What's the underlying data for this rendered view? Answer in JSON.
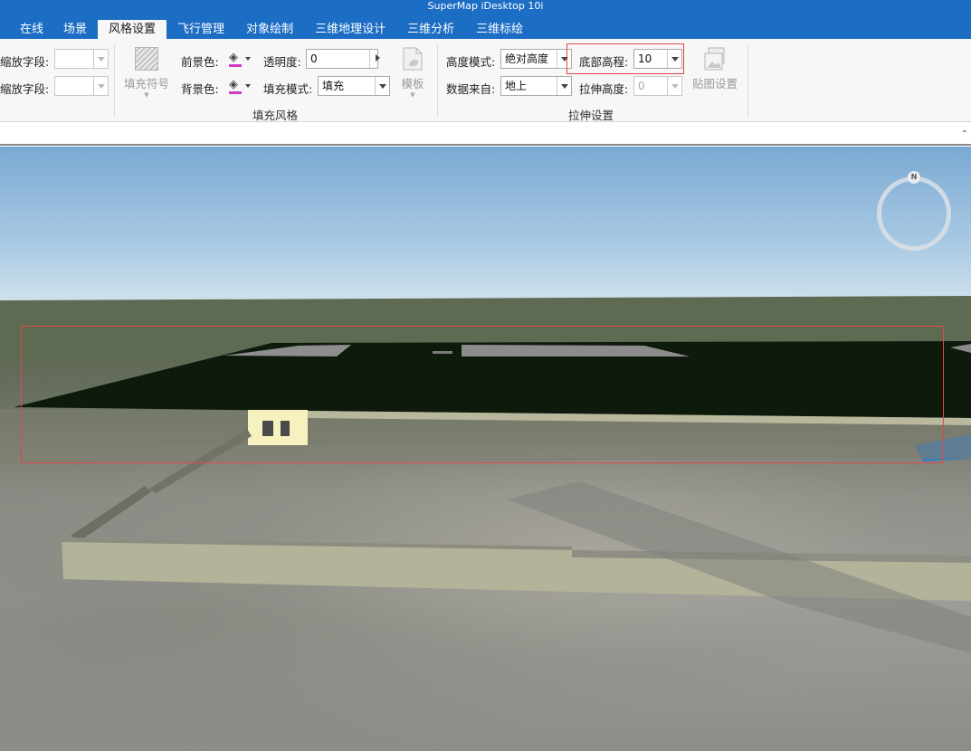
{
  "window": {
    "title": "SuperMap iDesktop 10i"
  },
  "tabs": [
    {
      "label": "在线",
      "active": false
    },
    {
      "label": "场景",
      "active": false
    },
    {
      "label": "风格设置",
      "active": true
    },
    {
      "label": "飞行管理",
      "active": false
    },
    {
      "label": "对象绘制",
      "active": false
    },
    {
      "label": "三维地理设计",
      "active": false
    },
    {
      "label": "三维分析",
      "active": false
    },
    {
      "label": "三维标绘",
      "active": false
    }
  ],
  "ribbon": {
    "scale_field_1": {
      "label": "缩放字段:",
      "value": ""
    },
    "scale_field_2": {
      "label": "缩放字段:",
      "value": ""
    },
    "fill_symbol": {
      "label": "填充符号"
    },
    "foreground": {
      "label": "前景色:"
    },
    "background": {
      "label": "背景色:"
    },
    "transparency": {
      "label": "透明度:",
      "value": "0"
    },
    "fill_mode": {
      "label": "填充模式:",
      "value": "填充"
    },
    "template": {
      "label": "模板"
    },
    "fill_style_group": "填充风格",
    "height_mode": {
      "label": "高度模式:",
      "value": "绝对高度"
    },
    "data_source": {
      "label": "数据来自:",
      "value": "地上"
    },
    "bottom_elevation": {
      "label": "底部高程:",
      "value": "10"
    },
    "extrude_height": {
      "label": "拉伸高度:",
      "value": "0"
    },
    "texture_settings": {
      "label": "贴图设置"
    },
    "extrude_group": "拉伸设置"
  },
  "scene": {
    "compass_label": "N",
    "chevron": "⌃"
  },
  "colors": {
    "accent": "#1c6dc4",
    "highlight": "#e04848",
    "swatch": "#d63ac5"
  }
}
